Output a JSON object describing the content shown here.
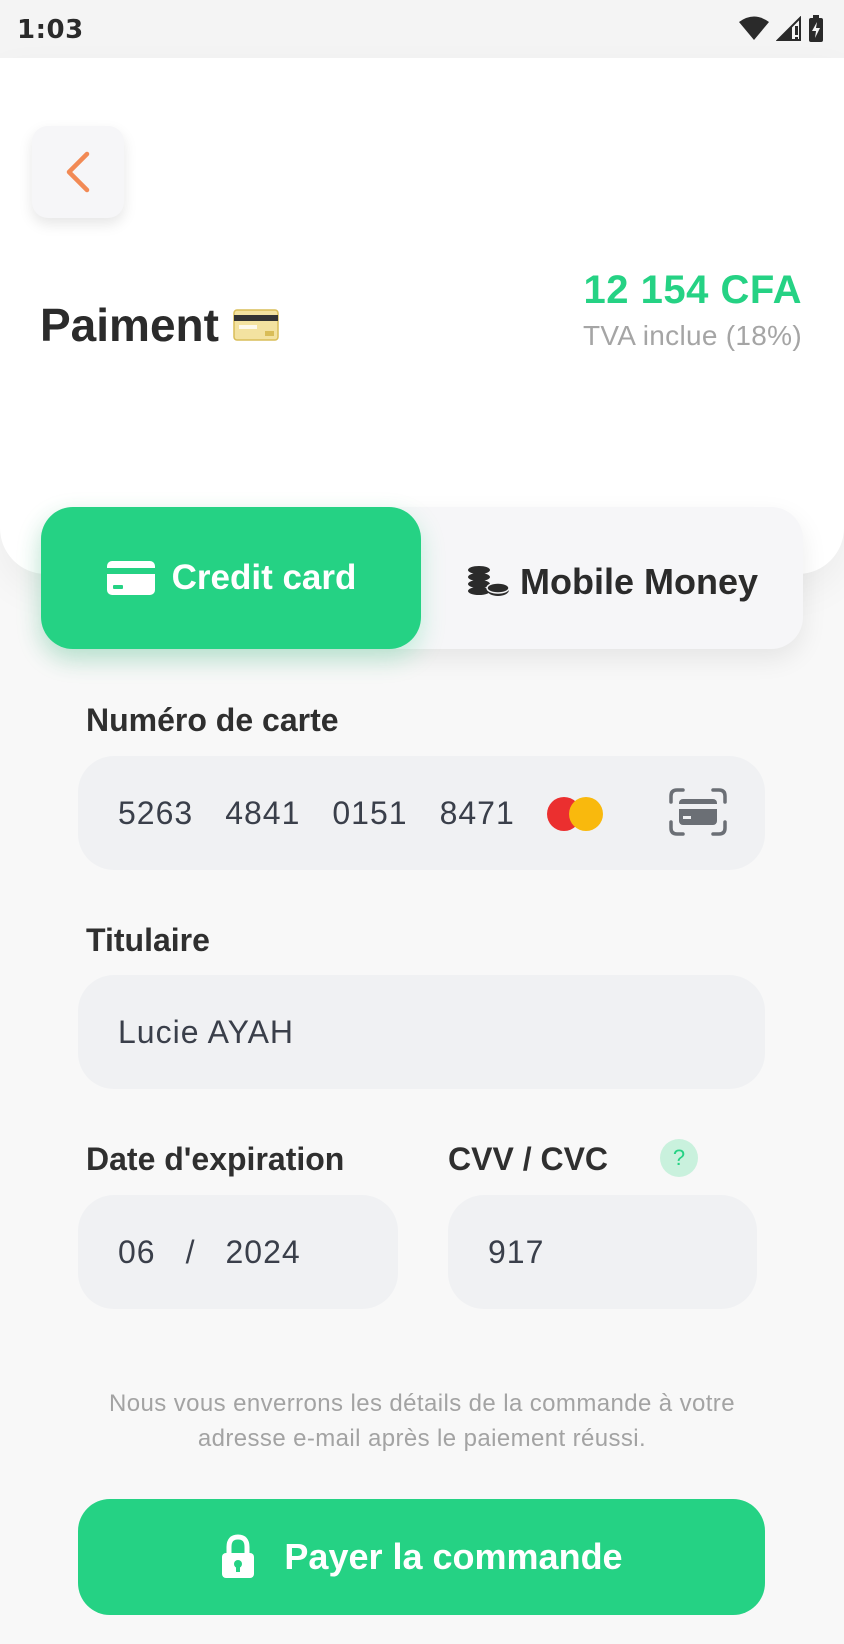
{
  "status_bar": {
    "time": "1:03"
  },
  "header": {
    "title": "Paiment",
    "amount": "12 154 CFA",
    "tax_note": "TVA inclue (18%)"
  },
  "tabs": [
    {
      "label": "Credit card",
      "icon": "credit-card-icon",
      "active": true
    },
    {
      "label": "Mobile Money",
      "icon": "coins-icon",
      "active": false
    }
  ],
  "form": {
    "card_number_label": "Numéro de carte",
    "card_number_groups": [
      "5263",
      "4841",
      "0151",
      "8471"
    ],
    "holder_label": "Titulaire",
    "holder_value": "Lucie AYAH",
    "expiry_label": "Date d'expiration",
    "expiry_month": "06",
    "expiry_sep": "/",
    "expiry_year": "2024",
    "cvv_label": "CVV / CVC",
    "cvv_help": "?",
    "cvv_value": "917"
  },
  "note": "Nous vous enverrons les détails de la commande à votre adresse e-mail après le paiement réussi.",
  "pay_button": {
    "label": "Payer la commande",
    "icon": "lock-icon"
  },
  "colors": {
    "accent": "#25d284",
    "back_arrow": "#f28a55",
    "field_bg": "#f0f1f3"
  }
}
